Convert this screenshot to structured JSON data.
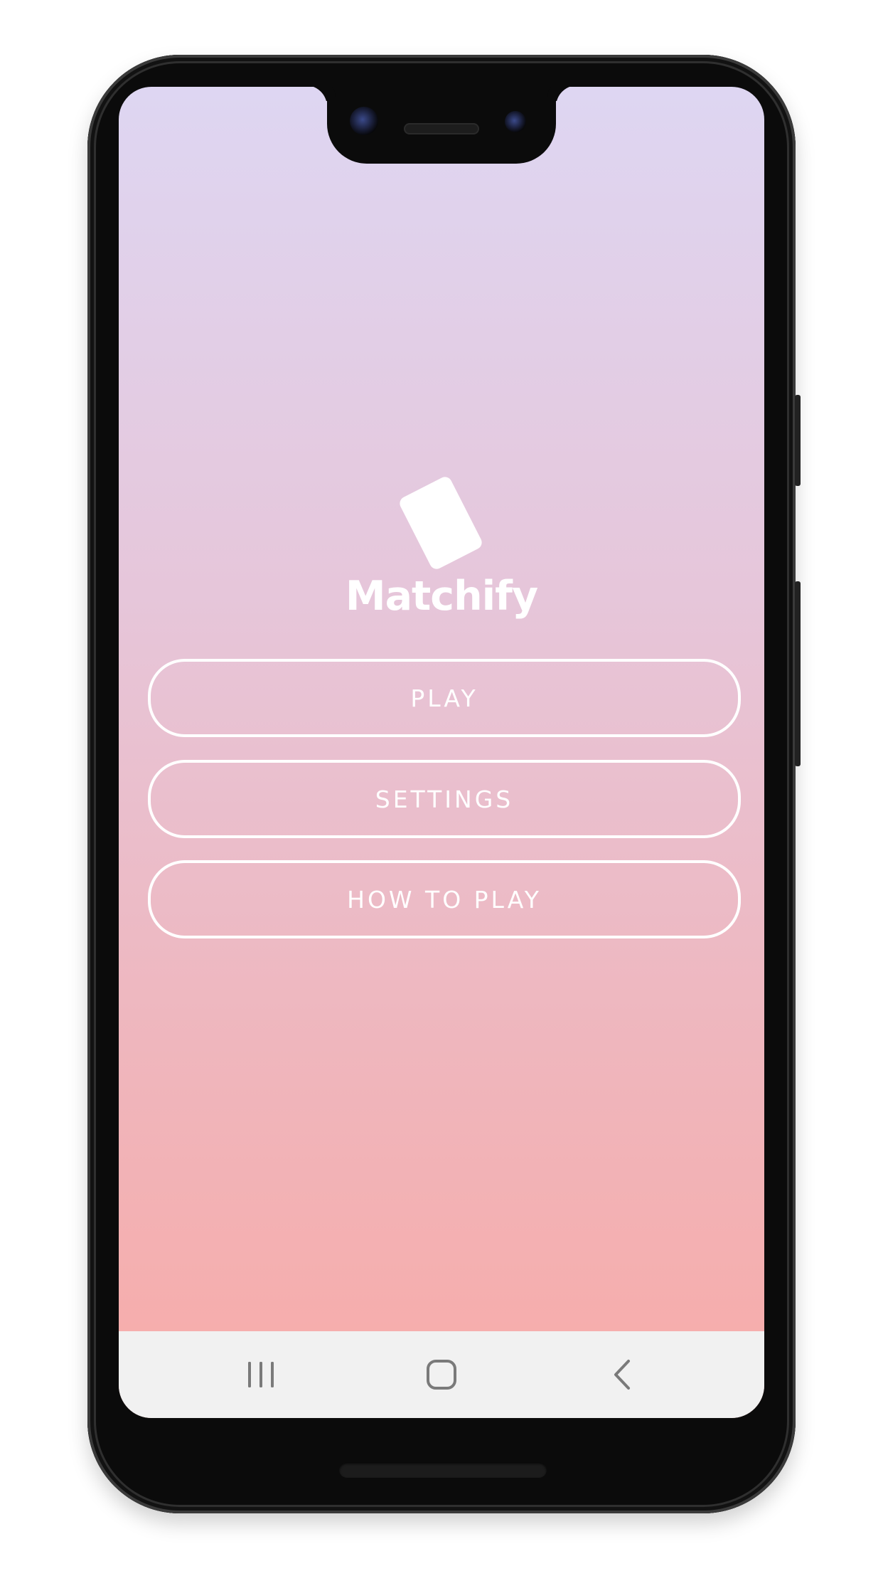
{
  "app": {
    "title": "Matchify",
    "logo_icon": "card-icon"
  },
  "menu": {
    "play_label": "PLAY",
    "settings_label": "SETTINGS",
    "how_to_play_label": "HOW TO PLAY"
  },
  "navbar": {
    "recent_icon": "recent-apps-icon",
    "home_icon": "home-icon",
    "back_icon": "back-icon"
  },
  "colors": {
    "gradient_top": "#ded6f2",
    "gradient_bottom": "#f8aba8",
    "button_outline": "#ffffff",
    "navbar_bg": "#f1f1f1",
    "nav_icon": "#7a7a7a"
  }
}
